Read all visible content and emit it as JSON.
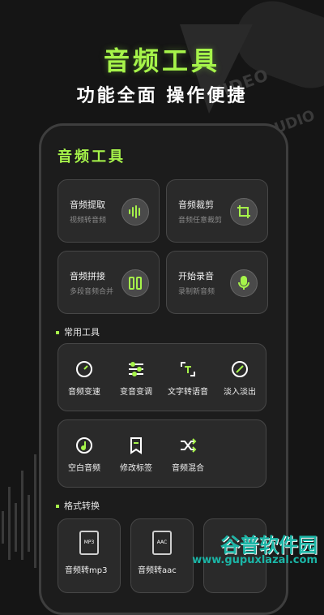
{
  "hero": {
    "title": "音频工具",
    "subtitle": "功能全面 操作便捷",
    "bg_words": [
      "VIDEO",
      "UDIO"
    ]
  },
  "app": {
    "title": "音频工具",
    "feature_cards": [
      {
        "title": "音频提取",
        "subtitle": "视频转音频",
        "icon": "waveform-icon"
      },
      {
        "title": "音频裁剪",
        "subtitle": "音频任意裁剪",
        "icon": "crop-icon"
      },
      {
        "title": "音频拼接",
        "subtitle": "多段音频合并",
        "icon": "merge-bars-icon"
      },
      {
        "title": "开始录音",
        "subtitle": "录制新音频",
        "icon": "microphone-icon"
      }
    ],
    "common_section": "常用工具",
    "common_tools_row1": [
      {
        "label": "音频变速",
        "icon": "speedometer-icon"
      },
      {
        "label": "变音变调",
        "icon": "sliders-icon"
      },
      {
        "label": "文字转语音",
        "icon": "text-to-speech-icon"
      },
      {
        "label": "淡入淡出",
        "icon": "fade-icon"
      }
    ],
    "common_tools_row2": [
      {
        "label": "空白音频",
        "icon": "music-note-icon"
      },
      {
        "label": "修改标签",
        "icon": "bookmark-icon"
      },
      {
        "label": "音频混合",
        "icon": "shuffle-icon"
      }
    ],
    "format_section": "格式转换",
    "format_cards": [
      {
        "label": "音频转mp3",
        "badge": "MP3"
      },
      {
        "label": "音频转aac",
        "badge": "AAC"
      }
    ]
  },
  "watermark": {
    "line1": "谷普软件园",
    "line2": "www.gupuxlazal.com"
  },
  "colors": {
    "accent": "#a6f44a",
    "background": "#151515",
    "card": "#2a2a2a",
    "watermark": "#1bb5a6"
  }
}
